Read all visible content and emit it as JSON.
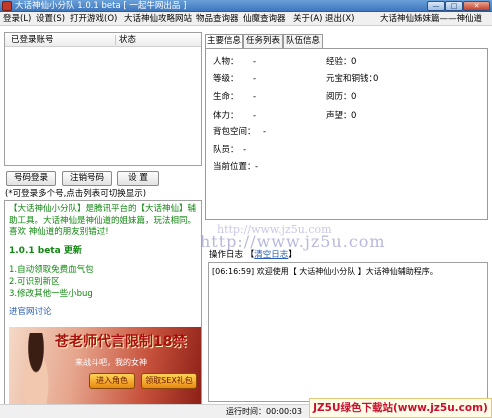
{
  "window": {
    "title": "大话神仙小分队 1.0.1 beta [ 一起牛网出品 ]",
    "btn_min": "—",
    "btn_max": "□",
    "btn_close": "✕"
  },
  "menu": {
    "items": [
      "登录(L)",
      "设置(S)",
      "打开游戏(O)",
      "大话神仙攻略网站",
      "物品查询器",
      "仙魔查询器",
      "关于(A)",
      "退出(X)"
    ],
    "right_text": "大话神仙姊妹篇——神仙道"
  },
  "accounts": {
    "col_account": "已登录账号",
    "col_status": "状态"
  },
  "buttons": {
    "login": "号码登录",
    "logout": "注销号码",
    "settings": "设 置"
  },
  "hint": "(*可登录多个号,点击列表可切换显示)",
  "announce": {
    "intro": "【大话神仙小分队】是腾讯平台的【大话神仙】辅助工具。大话神仙是神仙道的姐妹篇，玩法相同。喜欢 神仙道的朋友别错过!",
    "version": "1.0.1 beta 更新",
    "items": [
      "1.自动领取免费血气包",
      "2.可识别新区",
      "3.修改其他一些小bug"
    ],
    "link": "进官网讨论"
  },
  "ad": {
    "headline": "苍老师代言限制18禁",
    "subline": "来战斗吧，我的女神",
    "enter": "进入角色",
    "gift": "领取SEX礼包"
  },
  "tabs": [
    "主要信息",
    "任务列表",
    "队伍信息"
  ],
  "info": {
    "person_label": "人物：",
    "person_value": "-",
    "level_label": "等级：",
    "level_value": "-",
    "life_label": "生命：",
    "life_value": "-",
    "stamina_label": "体力：",
    "stamina_value": "-",
    "bag_label": "背包空间：",
    "bag_value": "-",
    "team_label": "队员：",
    "team_value": "-",
    "location_label": "当前位置：",
    "location_value": "-",
    "exp_label": "经验：",
    "exp_value": "0",
    "gold_label": "元宝和铜钱：",
    "gold_value": "0",
    "history_label": "阅历：",
    "history_value": "0",
    "fame_label": "声望：",
    "fame_value": "0"
  },
  "watermark_url_small": "http://www.jz5u.com",
  "watermark_url_large": "http://www.jz5u.com",
  "log": {
    "label": "操作日志",
    "clear": "清空日志",
    "lines": [
      "[06:16:59] 欢迎使用【 大话神仙小分队 】大话神仙辅助程序。"
    ]
  },
  "status": {
    "runtime_label": "运行时间：",
    "runtime_value": "00:00:03"
  },
  "site_watermark": "JZ5U绿色下载站(www.jz5u.com)"
}
